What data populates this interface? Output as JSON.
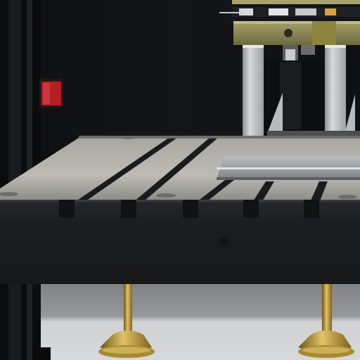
{
  "scene": {
    "description_free": true,
    "palette": {
      "background": "#0f1012",
      "wall": "#121316",
      "column_dark": "#0c0d0f",
      "table_top_light": "#b8b6b0",
      "table_top_mid": "#8e8c87",
      "table_front": "#1d1e21",
      "fixture_plate": "#aeb2b4",
      "fixture_pillar": "#c9cdd0",
      "gold": "#c9a447",
      "gold_dark": "#7a5f1f",
      "floor_light": "#cfd1d2",
      "floor_dark": "#8b8d8e",
      "red_light": "#b31f25"
    },
    "icons": {
      "red_indicator": "red-light-indicator-icon",
      "mount_hole": "mount-hole-icon"
    },
    "t_slot_count": 5,
    "leveling_feet_count": 2
  }
}
